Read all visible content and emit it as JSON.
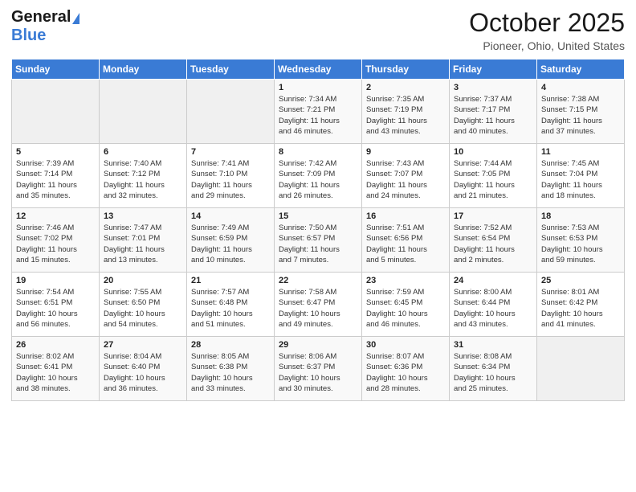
{
  "header": {
    "logo_line1": "General",
    "logo_line2": "Blue",
    "title": "October 2025",
    "subtitle": "Pioneer, Ohio, United States"
  },
  "days_of_week": [
    "Sunday",
    "Monday",
    "Tuesday",
    "Wednesday",
    "Thursday",
    "Friday",
    "Saturday"
  ],
  "weeks": [
    [
      {
        "day": "",
        "info": ""
      },
      {
        "day": "",
        "info": ""
      },
      {
        "day": "",
        "info": ""
      },
      {
        "day": "1",
        "info": "Sunrise: 7:34 AM\nSunset: 7:21 PM\nDaylight: 11 hours\nand 46 minutes."
      },
      {
        "day": "2",
        "info": "Sunrise: 7:35 AM\nSunset: 7:19 PM\nDaylight: 11 hours\nand 43 minutes."
      },
      {
        "day": "3",
        "info": "Sunrise: 7:37 AM\nSunset: 7:17 PM\nDaylight: 11 hours\nand 40 minutes."
      },
      {
        "day": "4",
        "info": "Sunrise: 7:38 AM\nSunset: 7:15 PM\nDaylight: 11 hours\nand 37 minutes."
      }
    ],
    [
      {
        "day": "5",
        "info": "Sunrise: 7:39 AM\nSunset: 7:14 PM\nDaylight: 11 hours\nand 35 minutes."
      },
      {
        "day": "6",
        "info": "Sunrise: 7:40 AM\nSunset: 7:12 PM\nDaylight: 11 hours\nand 32 minutes."
      },
      {
        "day": "7",
        "info": "Sunrise: 7:41 AM\nSunset: 7:10 PM\nDaylight: 11 hours\nand 29 minutes."
      },
      {
        "day": "8",
        "info": "Sunrise: 7:42 AM\nSunset: 7:09 PM\nDaylight: 11 hours\nand 26 minutes."
      },
      {
        "day": "9",
        "info": "Sunrise: 7:43 AM\nSunset: 7:07 PM\nDaylight: 11 hours\nand 24 minutes."
      },
      {
        "day": "10",
        "info": "Sunrise: 7:44 AM\nSunset: 7:05 PM\nDaylight: 11 hours\nand 21 minutes."
      },
      {
        "day": "11",
        "info": "Sunrise: 7:45 AM\nSunset: 7:04 PM\nDaylight: 11 hours\nand 18 minutes."
      }
    ],
    [
      {
        "day": "12",
        "info": "Sunrise: 7:46 AM\nSunset: 7:02 PM\nDaylight: 11 hours\nand 15 minutes."
      },
      {
        "day": "13",
        "info": "Sunrise: 7:47 AM\nSunset: 7:01 PM\nDaylight: 11 hours\nand 13 minutes."
      },
      {
        "day": "14",
        "info": "Sunrise: 7:49 AM\nSunset: 6:59 PM\nDaylight: 11 hours\nand 10 minutes."
      },
      {
        "day": "15",
        "info": "Sunrise: 7:50 AM\nSunset: 6:57 PM\nDaylight: 11 hours\nand 7 minutes."
      },
      {
        "day": "16",
        "info": "Sunrise: 7:51 AM\nSunset: 6:56 PM\nDaylight: 11 hours\nand 5 minutes."
      },
      {
        "day": "17",
        "info": "Sunrise: 7:52 AM\nSunset: 6:54 PM\nDaylight: 11 hours\nand 2 minutes."
      },
      {
        "day": "18",
        "info": "Sunrise: 7:53 AM\nSunset: 6:53 PM\nDaylight: 10 hours\nand 59 minutes."
      }
    ],
    [
      {
        "day": "19",
        "info": "Sunrise: 7:54 AM\nSunset: 6:51 PM\nDaylight: 10 hours\nand 56 minutes."
      },
      {
        "day": "20",
        "info": "Sunrise: 7:55 AM\nSunset: 6:50 PM\nDaylight: 10 hours\nand 54 minutes."
      },
      {
        "day": "21",
        "info": "Sunrise: 7:57 AM\nSunset: 6:48 PM\nDaylight: 10 hours\nand 51 minutes."
      },
      {
        "day": "22",
        "info": "Sunrise: 7:58 AM\nSunset: 6:47 PM\nDaylight: 10 hours\nand 49 minutes."
      },
      {
        "day": "23",
        "info": "Sunrise: 7:59 AM\nSunset: 6:45 PM\nDaylight: 10 hours\nand 46 minutes."
      },
      {
        "day": "24",
        "info": "Sunrise: 8:00 AM\nSunset: 6:44 PM\nDaylight: 10 hours\nand 43 minutes."
      },
      {
        "day": "25",
        "info": "Sunrise: 8:01 AM\nSunset: 6:42 PM\nDaylight: 10 hours\nand 41 minutes."
      }
    ],
    [
      {
        "day": "26",
        "info": "Sunrise: 8:02 AM\nSunset: 6:41 PM\nDaylight: 10 hours\nand 38 minutes."
      },
      {
        "day": "27",
        "info": "Sunrise: 8:04 AM\nSunset: 6:40 PM\nDaylight: 10 hours\nand 36 minutes."
      },
      {
        "day": "28",
        "info": "Sunrise: 8:05 AM\nSunset: 6:38 PM\nDaylight: 10 hours\nand 33 minutes."
      },
      {
        "day": "29",
        "info": "Sunrise: 8:06 AM\nSunset: 6:37 PM\nDaylight: 10 hours\nand 30 minutes."
      },
      {
        "day": "30",
        "info": "Sunrise: 8:07 AM\nSunset: 6:36 PM\nDaylight: 10 hours\nand 28 minutes."
      },
      {
        "day": "31",
        "info": "Sunrise: 8:08 AM\nSunset: 6:34 PM\nDaylight: 10 hours\nand 25 minutes."
      },
      {
        "day": "",
        "info": ""
      }
    ]
  ]
}
